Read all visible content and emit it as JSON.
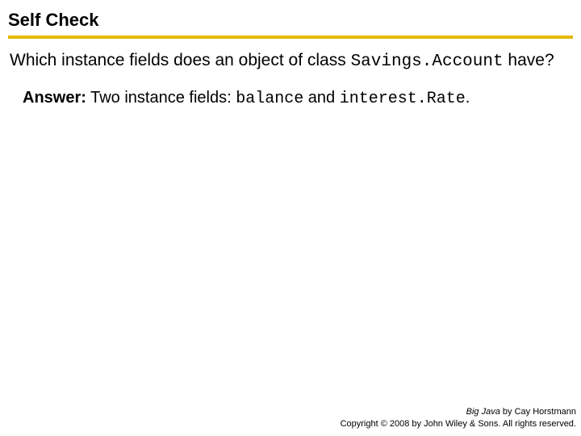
{
  "title": "Self Check",
  "question": {
    "pre": "Which instance fields does an object of class ",
    "code": "Savings.Account",
    "post": " have?"
  },
  "answer": {
    "label": "Answer:",
    "pre": " Two instance fields: ",
    "code1": "balance",
    "mid": " and ",
    "code2": "interest.Rate",
    "post": "."
  },
  "footer": {
    "book": "Big Java",
    "byline": " by Cay Horstmann",
    "copyright": "Copyright © 2008 by John Wiley & Sons. All rights reserved."
  }
}
